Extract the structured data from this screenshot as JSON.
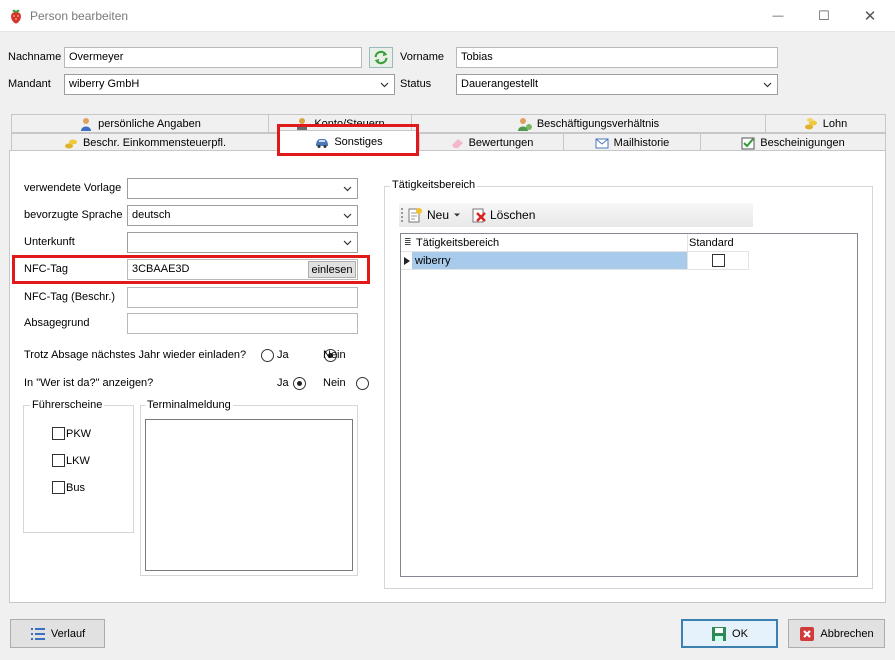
{
  "window": {
    "title": "Person bearbeiten",
    "minimize": "—",
    "maximize": "☐",
    "close": "✕"
  },
  "header": {
    "nachname_label": "Nachname",
    "nachname_value": "Overmeyer",
    "vorname_label": "Vorname",
    "vorname_value": "Tobias",
    "mandant_label": "Mandant",
    "mandant_value": "wiberry GmbH",
    "status_label": "Status",
    "status_value": "Dauerangestellt"
  },
  "tabs": {
    "row1": [
      "persönliche Angaben",
      "Konto/Steuern",
      "Beschäftigungsverhältnis",
      "Lohn"
    ],
    "row2": [
      "Beschr. Einkommensteuerpfl.",
      "Sonstiges",
      "Bewertungen",
      "Mailhistorie",
      "Bescheinigungen"
    ],
    "active": "Sonstiges"
  },
  "form": {
    "vorlage_label": "verwendete Vorlage",
    "vorlage_value": "",
    "sprache_label": "bevorzugte Sprache",
    "sprache_value": "deutsch",
    "unterkunft_label": "Unterkunft",
    "unterkunft_value": "",
    "nfc_label": "NFC-Tag",
    "nfc_value": "3CBAAE3D",
    "nfc_button": "einlesen",
    "nfc_beschr_label": "NFC-Tag (Beschr.)",
    "nfc_beschr_value": "",
    "absagegrund_label": "Absagegrund",
    "absagegrund_value": "",
    "einladen_question": "Trotz Absage nächstes Jahr wieder einladen?",
    "einladen_ja": "Ja",
    "einladen_nein": "Nein",
    "einladen_selected": "Nein",
    "werdaist_question": "In \"Wer ist da?\" anzeigen?",
    "werdaist_ja": "Ja",
    "werdaist_nein": "Nein",
    "werdaist_selected": "Ja"
  },
  "fuehrerscheine": {
    "title": "Führerscheine",
    "items": [
      "PKW",
      "LKW",
      "Bus"
    ]
  },
  "terminal": {
    "title": "Terminalmeldung",
    "value": ""
  },
  "taetigkeit": {
    "group_title": "Tätigkeitsbereich",
    "new_label": "Neu",
    "delete_label": "Löschen",
    "columns": [
      "Tätigkeitsbereich",
      "Standard"
    ],
    "rows": [
      {
        "name": "wiberry",
        "standard": false
      }
    ]
  },
  "footer": {
    "verlauf": "Verlauf",
    "ok": "OK",
    "abbrechen": "Abbrechen"
  },
  "colors": {
    "callout": "#e01a1a",
    "selection": "#a8caeb",
    "ok_border": "#3c7fb1"
  }
}
